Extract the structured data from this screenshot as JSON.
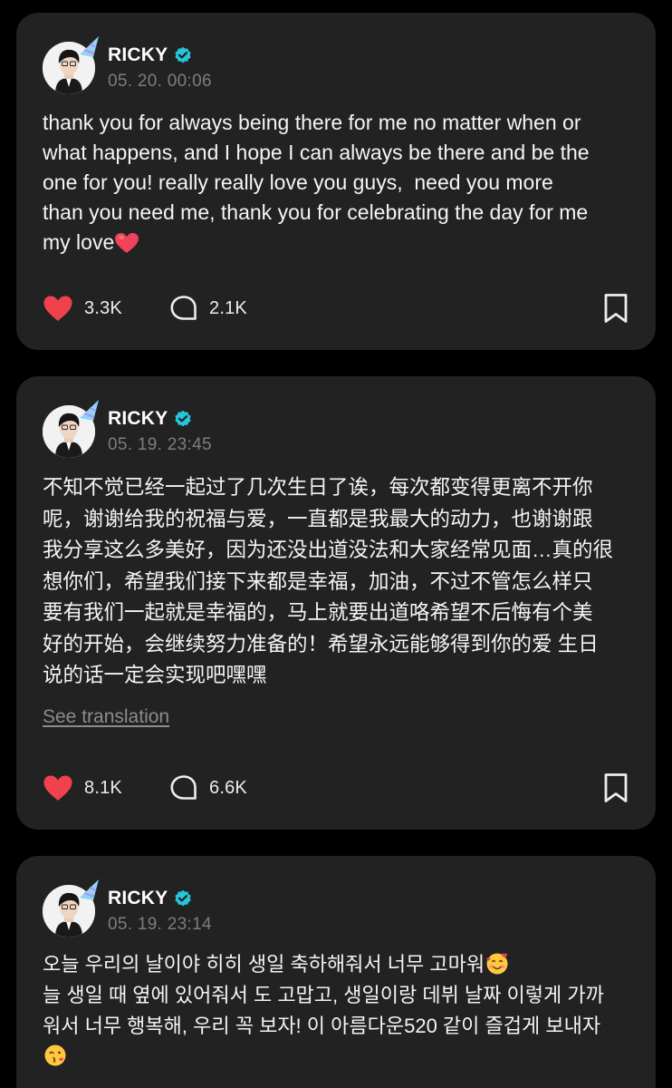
{
  "colors": {
    "background": "#000000",
    "card": "#222222",
    "text": "#f4f4f4",
    "muted": "#7d7d7d",
    "like": "#f0424d",
    "verified": "#26c6da"
  },
  "posts": [
    {
      "author": "RICKY",
      "timestamp": "05. 20. 00:06",
      "text": "thank you for always being there for me no matter when or\nwhat happens, and I hope I can always be there and be the\none for you! really really love you guys,  need you more\nthan you need me, thank you for celebrating the day for me\nmy love",
      "text_emoji": "red-heart",
      "likes": "3.3K",
      "comments": "2.1K"
    },
    {
      "author": "RICKY",
      "timestamp": "05. 19. 23:45",
      "text": "不知不觉已经一起过了几次生日了诶，每次都变得更离不开你\n呢，谢谢给我的祝福与爱，一直都是我最大的动力，也谢谢跟\n我分享这么多美好，因为还没出道没法和大家经常见面…真的很\n想你们，希望我们接下来都是幸福，加油，不过不管怎么样只\n要有我们一起就是幸福的，马上就要出道咯希望不后悔有个美\n好的开始，会继续努力准备的！希望永远能够得到你的爱 生日\n说的话一定会实现吧嘿嘿",
      "translation_link": "See translation",
      "likes": "8.1K",
      "comments": "6.6K"
    },
    {
      "author": "RICKY",
      "timestamp": "05. 19. 23:14",
      "text_line1": "오늘 우리의 날이야 히히 생일 축하해줘서 너무 고마워",
      "text_rest": "늘 생일 때 옆에 있어줘서 도 고맙고, 생일이랑 데뷔 날짜 이렇게 가까\n워서 너무 행복해, 우리 꼭 보자! 이 아름다운520 같이 즐겁게 보내자",
      "emoji_1": "smiling-face-with-hearts",
      "emoji_2": "face-blowing-kiss"
    }
  ]
}
